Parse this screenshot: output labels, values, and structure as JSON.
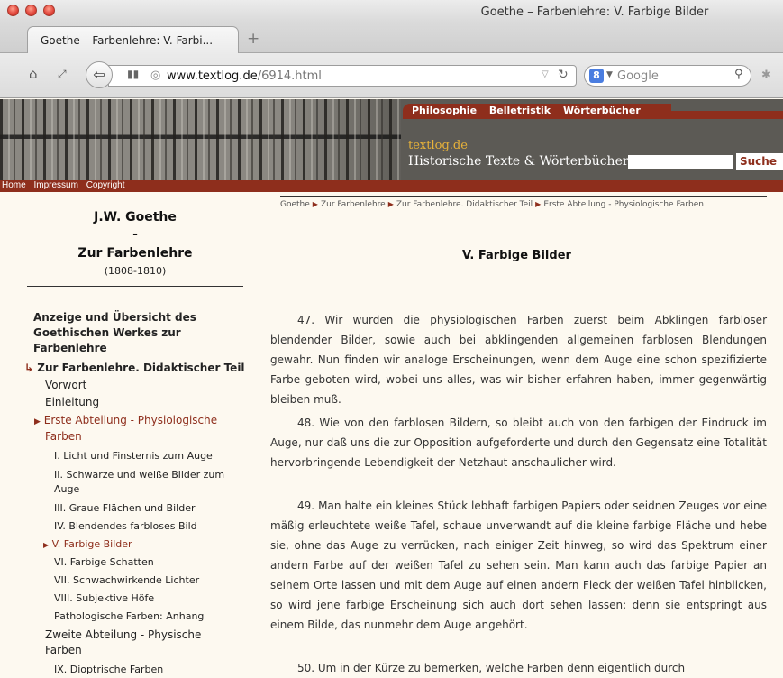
{
  "window": {
    "title": "Goethe – Farbenlehre: V. Farbige Bilder"
  },
  "tab": {
    "label": "Goethe – Farbenlehre: V. Farbi...",
    "new_tab": "+"
  },
  "nav": {
    "url_host": "www.textlog.de",
    "url_path": "/6914.html",
    "search_placeholder": "Google"
  },
  "site": {
    "topnav": [
      "Philosophie",
      "Belletristik",
      "Wörterbücher"
    ],
    "brand": "textlog.de",
    "tagline": "Historische Texte & Wörterbücher",
    "search_button": "Suche",
    "subnav": [
      "Home",
      "Impressum",
      "Copyright"
    ]
  },
  "sidebar": {
    "author": "J.W. Goethe",
    "dash": "-",
    "work": "Zur Farbenlehre",
    "years": "(1808-1810)",
    "toc": [
      {
        "label": "Anzeige und Übersicht des",
        "style": "bold"
      },
      {
        "label": "Goethischen Werkes zur",
        "style": "bold"
      },
      {
        "label": "Farbenlehre",
        "style": "bold"
      },
      {
        "label": "Zur Farbenlehre. Didaktischer Teil",
        "style": "bold"
      },
      {
        "label": "Vorwort",
        "style": "plain"
      },
      {
        "label": "Einleitung",
        "style": "plain"
      },
      {
        "label": "Erste Abteilung - Physiologische",
        "style": "red"
      },
      {
        "label": "Farben",
        "style": "red"
      },
      {
        "label": "I. Licht und Finsternis zum Auge",
        "style": "small"
      },
      {
        "label": "II. Schwarze und weiße Bilder zum",
        "style": "small"
      },
      {
        "label": "Auge",
        "style": "small"
      },
      {
        "label": "III. Graue Flächen und Bilder",
        "style": "small"
      },
      {
        "label": "IV. Blendendes farbloses Bild",
        "style": "small"
      },
      {
        "label": "V. Farbige Bilder",
        "style": "small-red"
      },
      {
        "label": "VI. Farbige Schatten",
        "style": "small"
      },
      {
        "label": "VII. Schwachwirkende Lichter",
        "style": "small"
      },
      {
        "label": "VIII. Subjektive Höfe",
        "style": "small"
      },
      {
        "label": "Pathologische Farben: Anhang",
        "style": "small"
      },
      {
        "label": "Zweite Abteilung - Physische",
        "style": "plain"
      },
      {
        "label": "Farben",
        "style": "plain"
      },
      {
        "label": "IX. Dioptrische Farben",
        "style": "small"
      }
    ]
  },
  "breadcrumb": [
    "Goethe",
    "Zur Farbenlehre",
    "Zur Farbenlehre. Didaktischer Teil",
    "Erste Abteilung - Physiologische Farben"
  ],
  "article": {
    "title": "V. Farbige Bilder",
    "paragraphs": [
      "47. Wir wurden die physiologischen Farben zuerst beim Abklingen farbloser blendender Bilder, sowie auch bei abklingenden allgemeinen farblosen Blendungen gewahr. Nun finden wir analoge Erscheinungen, wenn dem Auge eine schon spezifizierte Farbe geboten wird, wobei uns alles, was wir bisher erfahren haben, immer gegenwärtig bleiben muß.",
      "48. Wie von den farblosen Bildern, so bleibt auch von den farbigen der Eindruck im Auge, nur daß uns die zur Opposition aufgeforderte und durch den Gegensatz eine Totalität hervorbringende Lebendigkeit der Netzhaut anschaulicher wird.",
      "49. Man halte ein kleines Stück lebhaft farbigen Papiers oder seidnen Zeuges vor eine mäßig erleuchtete weiße Tafel, schaue unverwandt auf die kleine farbige Fläche und hebe sie, ohne das Auge zu verrücken, nach einiger Zeit hinweg, so wird das Spektrum einer andern Farbe auf der weißen Tafel zu sehen sein. Man kann auch das farbige Papier an seinem Orte lassen und mit dem Auge auf einen andern Fleck der weißen Tafel hinblicken, so wird jene farbige Erscheinung sich auch dort sehen lassen: denn sie entspringt aus einem Bilde, das nunmehr dem Auge angehört.",
      "50. Um in der Kürze zu bemerken, welche Farben denn eigentlich durch"
    ]
  }
}
